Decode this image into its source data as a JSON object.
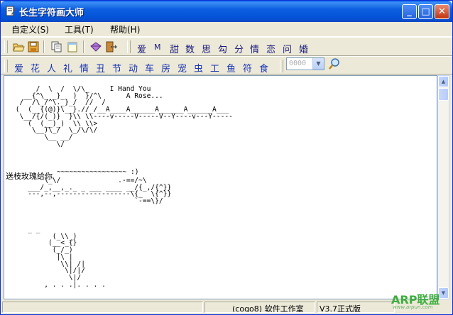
{
  "window": {
    "title": "长生字符画大师",
    "min_label": "_",
    "max_label": "□",
    "close_label": "✕"
  },
  "menu": [
    {
      "label": "自定义(S)"
    },
    {
      "label": "工具(T)"
    },
    {
      "label": "帮助(H)"
    }
  ],
  "toolbar1": {
    "icons": [
      "open-folder-icon",
      "save-disk-icon",
      "copy-icon",
      "notepad-icon",
      "gem-icon",
      "exit-door-icon"
    ],
    "categories": [
      "爱",
      "M",
      "甜",
      "数",
      "思",
      "勾",
      "分",
      "情",
      "恋",
      "问",
      "婚"
    ]
  },
  "toolbar2": {
    "categories": [
      "爱",
      "花",
      "人",
      "礼",
      "情",
      "丑",
      "节",
      "动",
      "车",
      "房",
      "宠",
      "虫",
      "工",
      "鱼",
      "符",
      "食"
    ],
    "combo_value": "0000"
  },
  "editor": {
    "art1": "      /  \\  /  \\/\\_     I Hand You\n   __{^\\_ _}_  )  }/^\\      A Rose...\n  /  /\\_/^\\._}_/  //  /\n (  (__{(@)}\\__}.//_/__A____A______A______A______A___\n  \\__/{/(_)}  }\\\\ \\\\----v-----V-----V--Y----v---Y-----\n    (  (__)_)  \\\\ \\\\>\n     \\__)\\_/  \\_/\\/\\/\n        \\__ __/\n           \\/",
    "caption": "送枝玫瑰给你",
    "art2_suffix": "~~~~~~~~~~~~~~~~~ :)",
    "art2": "        \\_\\/              .-==/~\\\n    ___/_,__,_._ _ ___ ____ __/{_,/{^}}\n    ---,--,------------------\\{_  \\{^}}\n                              `-==\\}/",
    "art3": "    _ _\n          (_\\\\_)\n         (__<_{}\n          (_/_)\n           |\\ |\n            \\\\| /|\n             \\|/|/\n              \\|/\n        , . . .|. . . ."
  },
  "status": {
    "left": "",
    "company": "(cogo8) 软件工作室",
    "version": "V3.7正式版"
  },
  "watermark": {
    "brand": "ARP联盟",
    "url": "www.arpun.com"
  }
}
